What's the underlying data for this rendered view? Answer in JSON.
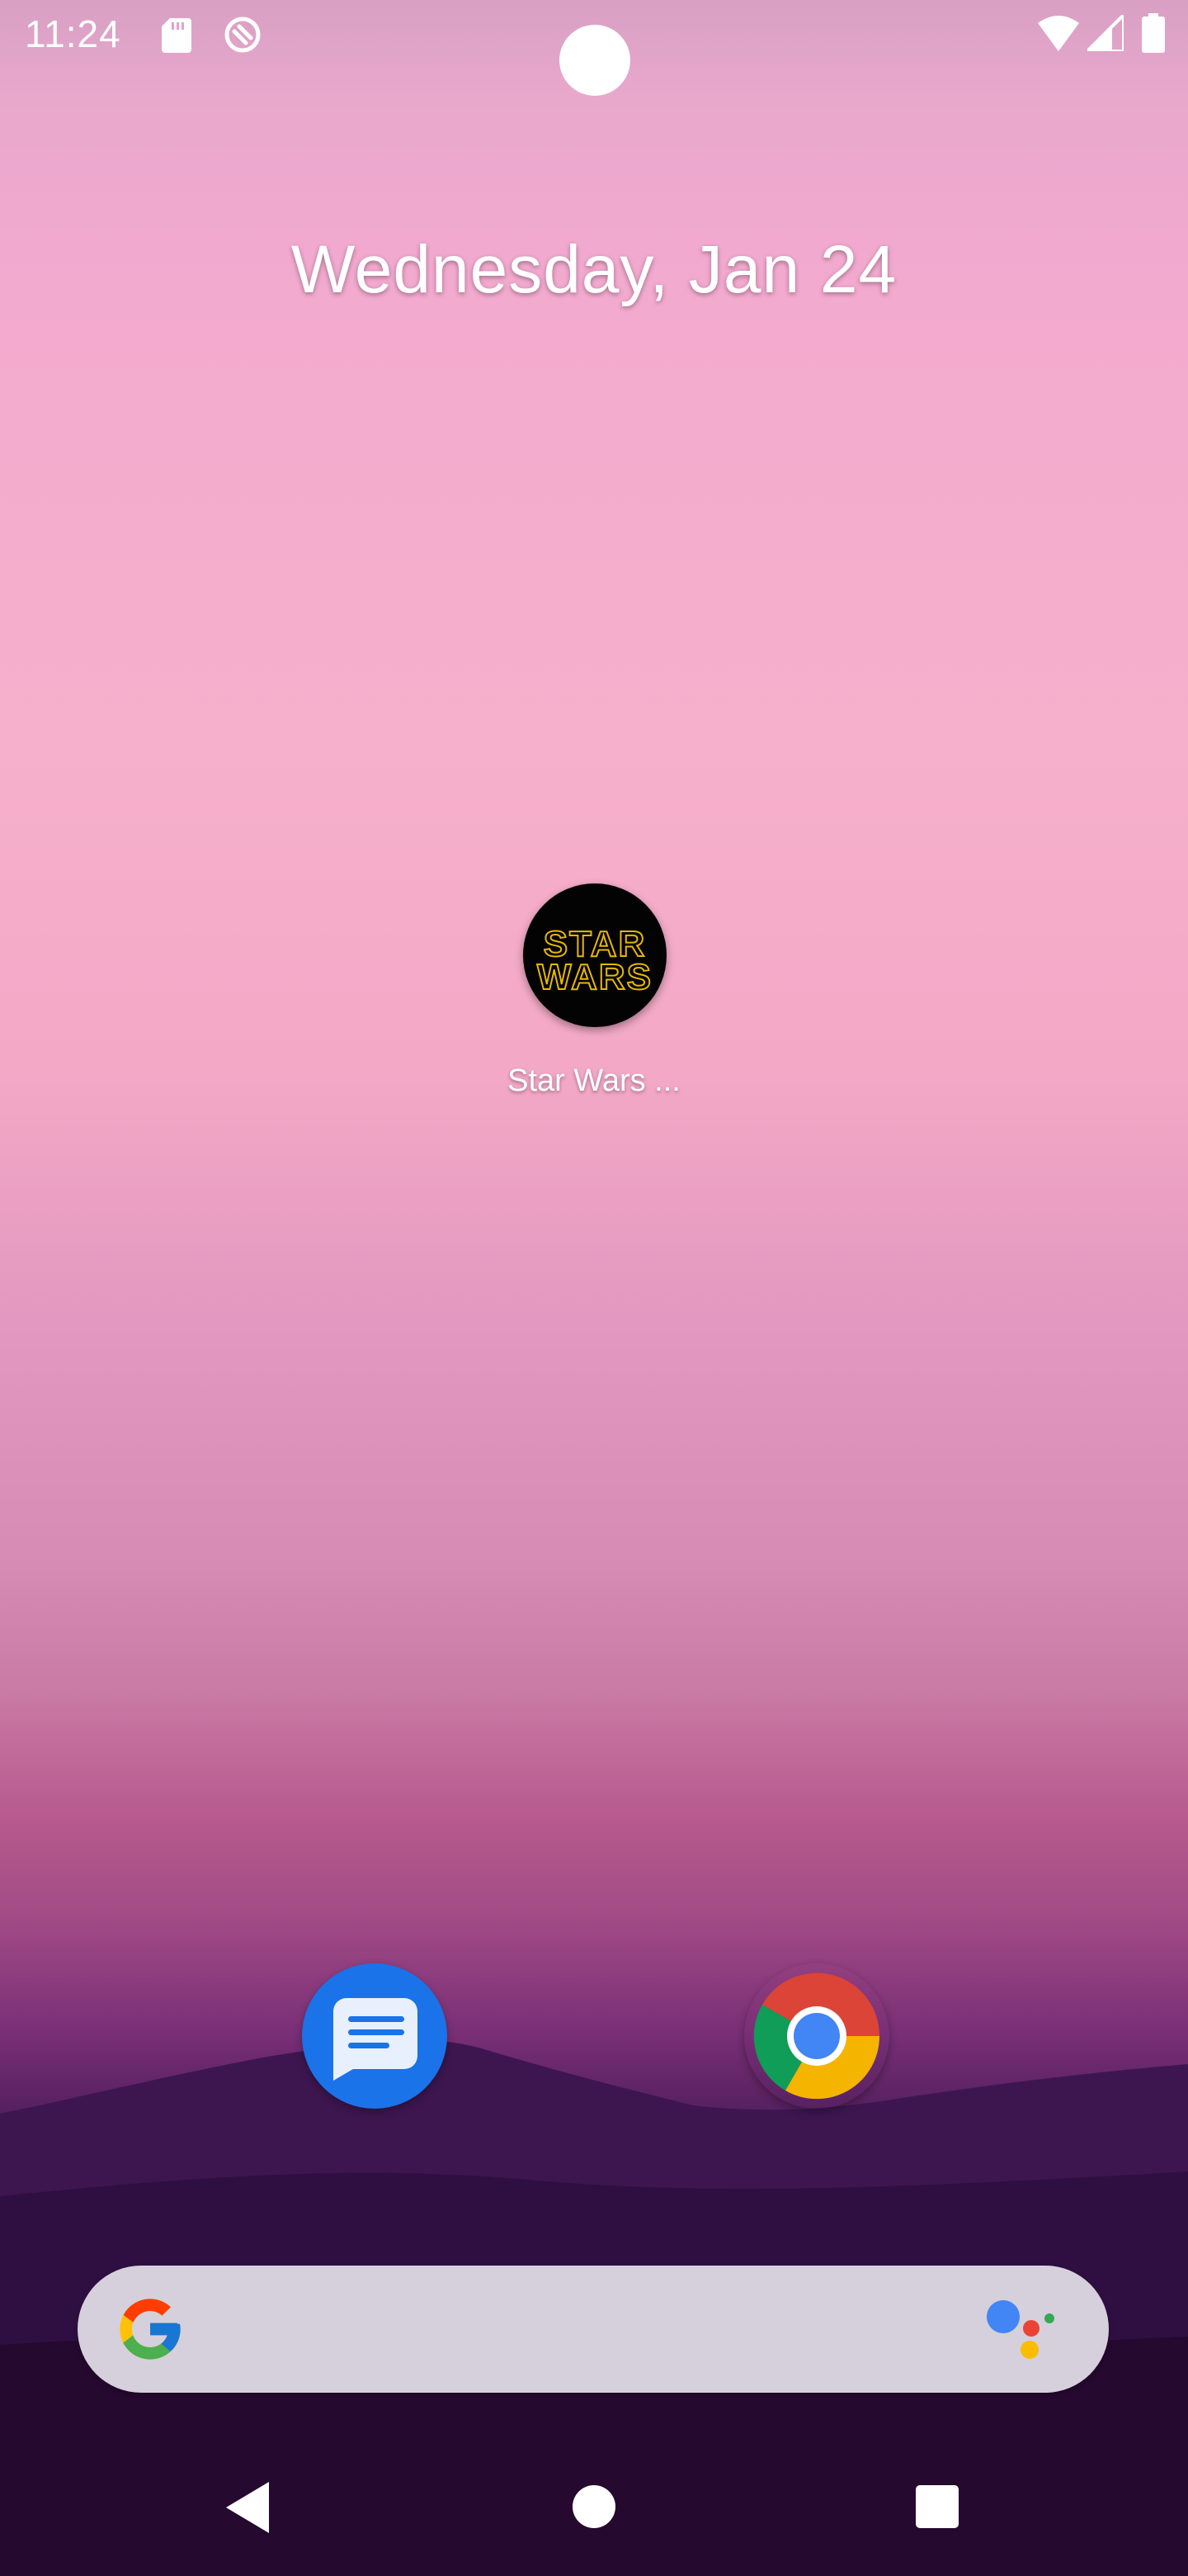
{
  "status_bar": {
    "time": "11:24",
    "icons": [
      "sd-card-icon",
      "vpn-icon",
      "wifi-icon",
      "cell-signal-icon",
      "battery-icon"
    ]
  },
  "home": {
    "date": "Wednesday, Jan 24",
    "shortcut": {
      "label": "Star Wars ...",
      "logo_line1": "STAR",
      "logo_line2": "WARS"
    }
  },
  "dock": {
    "apps": [
      "messages-icon",
      "chrome-icon"
    ]
  },
  "search": {
    "icons": [
      "google-g-icon",
      "assistant-icon"
    ]
  },
  "nav": {
    "buttons": [
      "back",
      "home",
      "recents"
    ]
  },
  "colors": {
    "messages_blue": "#1a73e8",
    "search_bar": "#d5d0dc",
    "logo_gold": "#e6b800"
  }
}
